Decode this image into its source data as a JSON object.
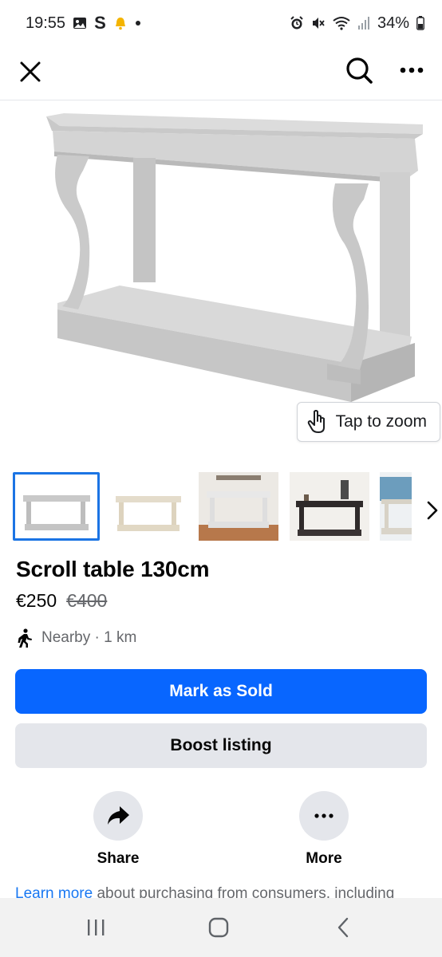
{
  "status_bar": {
    "time": "19:55",
    "s_label": "S",
    "battery": "34%",
    "left_icons": [
      "gallery-icon",
      "notification-bell-icon",
      "dot-icon"
    ],
    "right_icons": [
      "alarm-icon",
      "mute-icon",
      "wifi-icon",
      "signal-icon",
      "battery-icon"
    ]
  },
  "header": {
    "icons": [
      "close-icon",
      "search-icon",
      "more-options-icon"
    ]
  },
  "hero": {
    "zoom_label": "Tap to zoom",
    "zoom_icon": "tap-hand-icon"
  },
  "thumbnails": {
    "count": 5,
    "selected_index": 0,
    "next_icon": "chevron-right-icon"
  },
  "listing": {
    "title": "Scroll table 130cm",
    "price": "€250",
    "original_price": "€400",
    "location": "Nearby · 1 km",
    "location_icon": "walking-person-icon"
  },
  "buttons": {
    "primary": "Mark as Sold",
    "secondary": "Boost listing"
  },
  "actions": [
    {
      "label": "Share",
      "icon": "share-arrow-icon"
    },
    {
      "label": "More",
      "icon": "more-horizontal-icon"
    }
  ],
  "footer_text": {
    "link": "Learn more",
    "rest": " about purchasing from consumers, including"
  },
  "nav": {
    "icons": [
      "recent-apps-icon",
      "home-icon",
      "back-icon"
    ]
  },
  "colors": {
    "primary_blue": "#0866ff",
    "secondary_gray": "#e4e6eb",
    "link_blue": "#1877f2",
    "selected_border": "#1b74e4",
    "muted_text": "#65676b"
  }
}
